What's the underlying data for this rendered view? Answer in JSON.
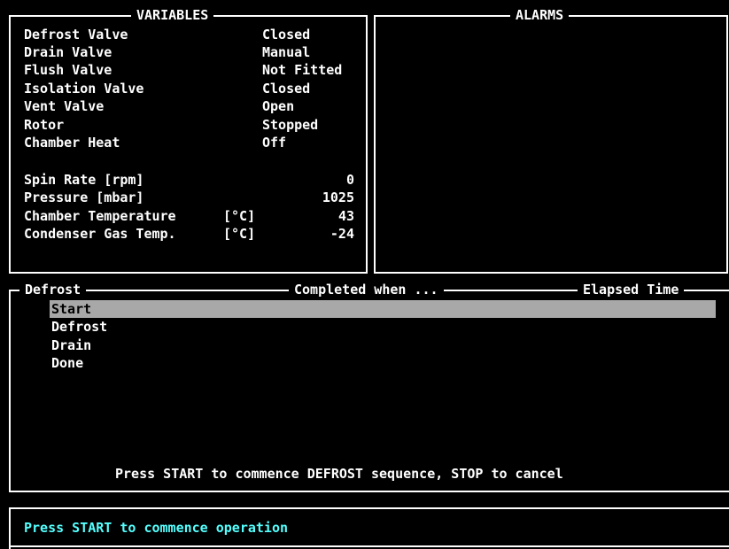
{
  "variables": {
    "title": "VARIABLES",
    "valves": [
      {
        "label": "Defrost Valve",
        "value": "Closed"
      },
      {
        "label": "Drain Valve",
        "value": "Manual"
      },
      {
        "label": "Flush Valve",
        "value": "Not Fitted"
      },
      {
        "label": "Isolation Valve",
        "value": "Closed"
      },
      {
        "label": "Vent Valve",
        "value": "Open"
      },
      {
        "label": "Rotor",
        "value": "Stopped"
      },
      {
        "label": "Chamber Heat",
        "value": "Off"
      }
    ],
    "measurements": [
      {
        "label": "Spin Rate [rpm]",
        "unit": "",
        "value": "0"
      },
      {
        "label": "Pressure [mbar]",
        "unit": "",
        "value": "1025"
      },
      {
        "label": "Chamber Temperature",
        "unit": "[°C]",
        "value": "43"
      },
      {
        "label": "Condenser Gas Temp.",
        "unit": "[°C]",
        "value": "-24"
      }
    ]
  },
  "alarms": {
    "title": "ALARMS"
  },
  "sequence": {
    "header_name": "Defrost",
    "header_completed": "Completed when ...",
    "header_elapsed": "Elapsed Time",
    "steps": [
      "Start",
      "Defrost",
      "Drain",
      "Done"
    ],
    "selected_index": 0,
    "instruction": "Press START to commence DEFROST sequence, STOP to cancel"
  },
  "status": {
    "message": "Press START to commence operation"
  },
  "colors": {
    "background": "#000000",
    "text": "#ffffff",
    "highlight": "#a8a8a8",
    "status_text": "#55ffff"
  }
}
